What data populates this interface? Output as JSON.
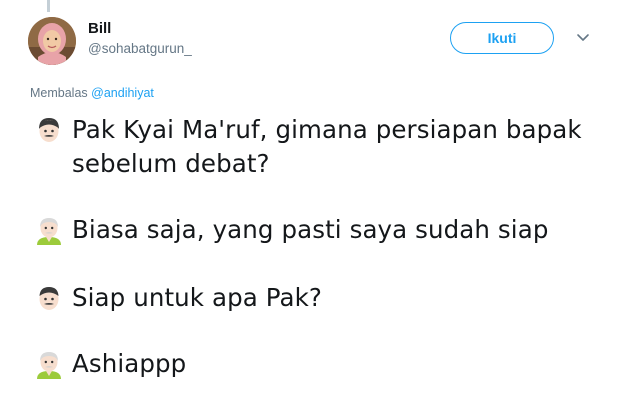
{
  "user": {
    "display_name": "Bill",
    "handle": "@sohabatgurun_"
  },
  "follow_button": {
    "label": "Ikuti"
  },
  "reply": {
    "prefix": "Membalas",
    "mention": "@andihiyat"
  },
  "tweet": {
    "lines": [
      {
        "speaker": "man-face-emoji",
        "text_1": "Pak Kyai Ma'ruf, gimana persiapan bapak",
        "text_2": "sebelum debat?"
      },
      {
        "speaker": "old-man-emoji",
        "text": "Biasa saja, yang pasti saya sudah siap"
      },
      {
        "speaker": "man-face-emoji",
        "text": "Siap untuk apa Pak?"
      },
      {
        "speaker": "old-man-emoji",
        "text": "Ashiappp"
      }
    ]
  },
  "colors": {
    "accent": "#1da1f2",
    "secondary_text": "#657786",
    "primary_text": "#14171a"
  },
  "icons": {
    "caret": "chevron-down-icon"
  }
}
